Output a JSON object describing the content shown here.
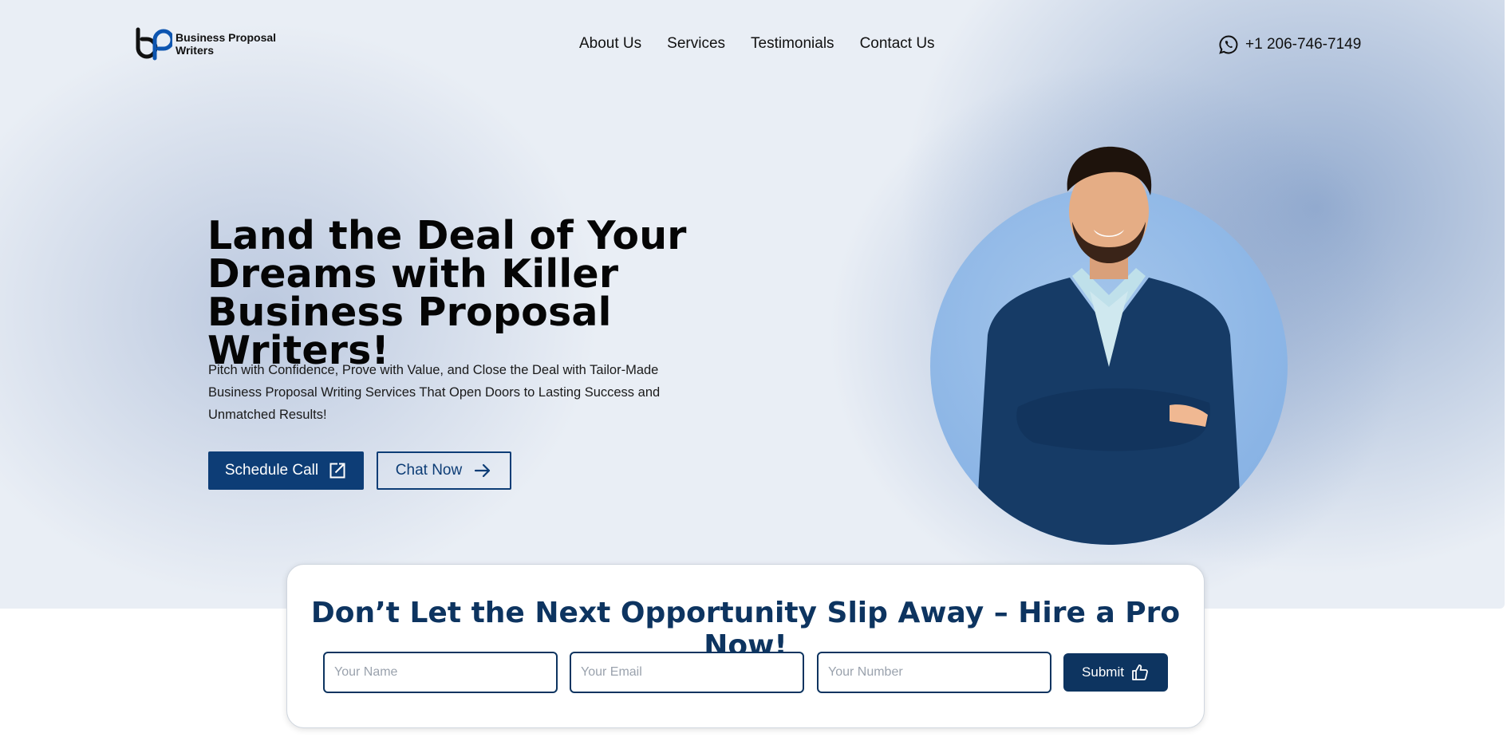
{
  "header": {
    "logo_text_line1": "Business Proposal",
    "logo_text_line2": "Writers",
    "nav": [
      "About Us",
      "Services",
      "Testimonials",
      "Contact Us"
    ],
    "phone": "+1 206-746-7149"
  },
  "hero": {
    "headline": "Land the Deal of Your Dreams with Killer Business Proposal Writers!",
    "subtext": "Pitch with Confidence, Prove with Value, and Close the Deal with Tailor-Made Business Proposal Writing Services That Open Doors to Lasting Success and Unmatched Results!",
    "primary_button": "Schedule Call",
    "secondary_button": "Chat Now"
  },
  "cta": {
    "title": "Don’t Let the Next Opportunity Slip Away – Hire a Pro Now!",
    "name_placeholder": "Your Name",
    "email_placeholder": "Your Email",
    "number_placeholder": "Your Number",
    "submit_label": "Submit"
  },
  "colors": {
    "brand_navy": "#0d3d76",
    "cta_navy": "#0d3460",
    "portrait_circle": "#8ab4e5"
  },
  "icons": {
    "logo": "bp-logo-icon",
    "phone": "whatsapp-icon",
    "schedule": "external-link-icon",
    "chat": "arrow-right-icon",
    "submit": "thumbs-up-icon"
  }
}
